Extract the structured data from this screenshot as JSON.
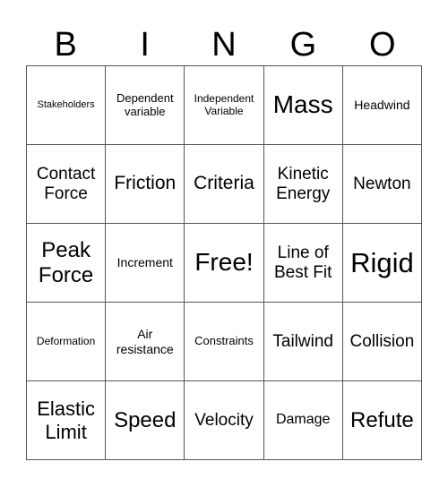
{
  "header": [
    "B",
    "I",
    "N",
    "G",
    "O"
  ],
  "cells": [
    [
      "Stakeholders",
      "Dependent variable",
      "Independent Variable",
      "Mass",
      "Headwind"
    ],
    [
      "Contact Force",
      "Friction",
      "Criteria",
      "Kinetic Energy",
      "Newton"
    ],
    [
      "Peak Force",
      "Increment",
      "Free!",
      "Line of Best Fit",
      "Rigid"
    ],
    [
      "Deformation",
      "Air resistance",
      "Constraints",
      "Tailwind",
      "Collision"
    ],
    [
      "Elastic Limit",
      "Speed",
      "Velocity",
      "Damage",
      "Refute"
    ]
  ]
}
